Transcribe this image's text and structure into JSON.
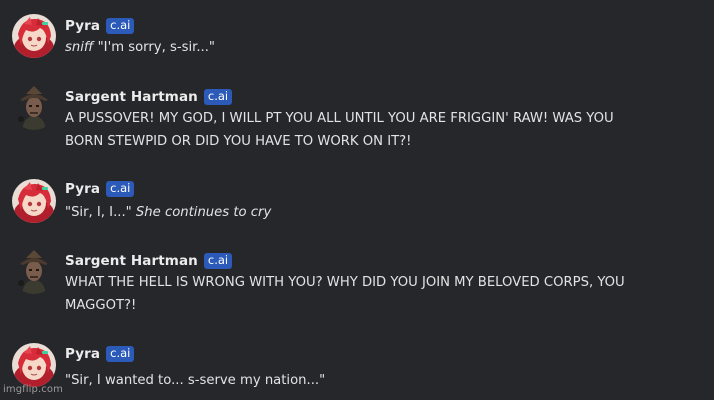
{
  "messages": [
    {
      "name": "Pyra",
      "badge": "c.ai",
      "line1_em": "sniff",
      "line1": " \"I'm sorry, s-sir...\""
    },
    {
      "name": "Sargent Hartman",
      "badge": "c.ai",
      "line1": "A PUSSOVER! MY GOD, I WILL PT YOU ALL UNTIL YOU ARE FRIGGIN' RAW! WAS YOU",
      "line2": "BORN STEWPID OR DID YOU HAVE TO WORK ON IT?!"
    },
    {
      "name": "Pyra",
      "badge": "c.ai",
      "line1": "\"Sir, I, I...\" ",
      "line1_em": "She continues to cry"
    },
    {
      "name": "Sargent Hartman",
      "badge": "c.ai",
      "line1": "WHAT THE HELL IS WRONG WITH YOU? WHY DID YOU JOIN MY BELOVED CORPS, YOU",
      "line2": "MAGGOT?!"
    },
    {
      "name": "Pyra",
      "badge": "c.ai",
      "line1": "\"Sir, I wanted to... s-serve my nation...\""
    }
  ],
  "watermark": "imgflip.com",
  "colors": {
    "background": "#26272b",
    "badge": "#2c5ab8",
    "text": "#e3e3e3"
  },
  "icons": {
    "pyra_avatar": "red-haired-anime-girl-avatar",
    "hartman_avatar": "drill-sergeant-avatar"
  }
}
